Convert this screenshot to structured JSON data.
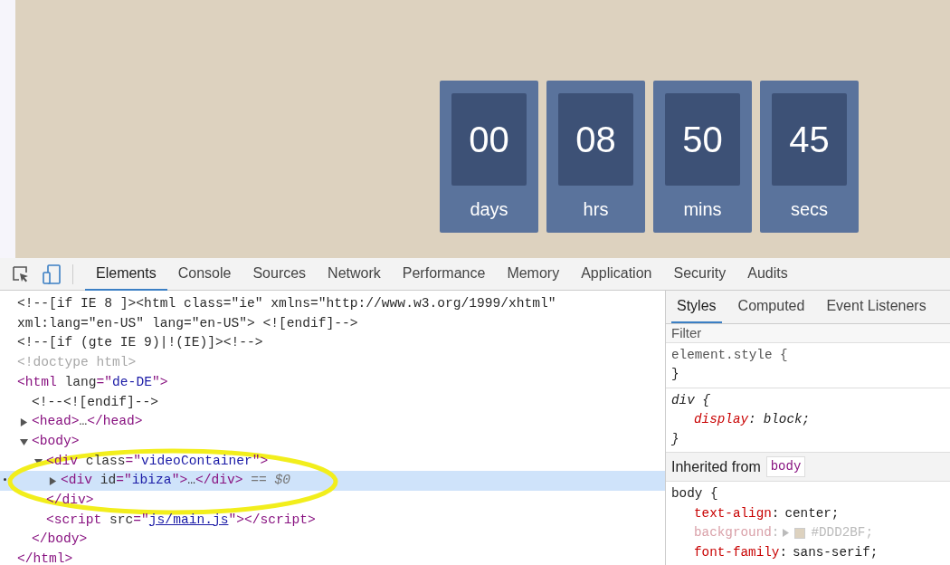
{
  "countdown": [
    {
      "value": "00",
      "label": "days"
    },
    {
      "value": "08",
      "label": "hrs"
    },
    {
      "value": "50",
      "label": "mins"
    },
    {
      "value": "45",
      "label": "secs"
    }
  ],
  "devtools": {
    "tabs": [
      {
        "label": "Elements",
        "selected": true
      },
      {
        "label": "Console",
        "selected": false
      },
      {
        "label": "Sources",
        "selected": false
      },
      {
        "label": "Network",
        "selected": false
      },
      {
        "label": "Performance",
        "selected": false
      },
      {
        "label": "Memory",
        "selected": false
      },
      {
        "label": "Application",
        "selected": false
      },
      {
        "label": "Security",
        "selected": false
      },
      {
        "label": "Audits",
        "selected": false
      }
    ],
    "dom_tree": [
      {
        "tokens": [
          {
            "kind": "comment",
            "text": "<!--[if IE 8 ]><html class=\"ie\" xmlns=\"http://www.w3.org/1999/xhtml\" xml:lang=\"en-US\" lang=\"en-US\"> <![endif]-->"
          }
        ],
        "selected": false
      },
      {
        "tokens": [
          {
            "kind": "comment",
            "text": "<!--[if (gte IE 9)|!(IE)]><!-->"
          }
        ],
        "selected": false
      },
      {
        "tokens": [
          {
            "kind": "doctype",
            "text": "<!doctype html>"
          }
        ],
        "selected": false
      },
      {
        "tokens": [
          {
            "kind": "tag",
            "text": "<html"
          },
          {
            "kind": "attr",
            "text": " lang"
          },
          {
            "kind": "tag",
            "text": "=\""
          },
          {
            "kind": "value",
            "text": "de-DE"
          },
          {
            "kind": "tag",
            "text": "\">"
          }
        ],
        "selected": false,
        "children": [
          {
            "tokens": [
              {
                "kind": "comment",
                "text": "<!--<![endif]-->"
              }
            ],
            "selected": false
          },
          {
            "tokens": [
              {
                "kind": "tag",
                "text": "<head>"
              },
              {
                "kind": "plain",
                "text": "…"
              },
              {
                "kind": "tag",
                "text": "</head>"
              }
            ],
            "expanded": false,
            "selected": false
          },
          {
            "tokens": [
              {
                "kind": "tag",
                "text": "<body>"
              }
            ],
            "expanded": true,
            "selected": false,
            "children": [
              {
                "tokens": [
                  {
                    "kind": "tag",
                    "text": "<div"
                  },
                  {
                    "kind": "attr",
                    "text": " class"
                  },
                  {
                    "kind": "tag",
                    "text": "=\""
                  },
                  {
                    "kind": "value",
                    "text": "videoContainer"
                  },
                  {
                    "kind": "tag",
                    "text": "\">"
                  }
                ],
                "expanded": true,
                "selected": false,
                "children": [
                  {
                    "tokens": [
                      {
                        "kind": "tag",
                        "text": "<div"
                      },
                      {
                        "kind": "attr",
                        "text": " id"
                      },
                      {
                        "kind": "tag",
                        "text": "=\""
                      },
                      {
                        "kind": "value",
                        "text": "ibiza"
                      },
                      {
                        "kind": "tag",
                        "text": "\">"
                      },
                      {
                        "kind": "plain",
                        "text": "…"
                      },
                      {
                        "kind": "tag",
                        "text": "</div>"
                      },
                      {
                        "kind": "marker",
                        "text": " == $0"
                      }
                    ],
                    "expanded": false,
                    "selected": true
                  }
                ],
                "close": [
                  {
                    "kind": "tag",
                    "text": "</div>"
                  }
                ]
              },
              {
                "tokens": [
                  {
                    "kind": "tag",
                    "text": "<script"
                  },
                  {
                    "kind": "attr",
                    "text": " src"
                  },
                  {
                    "kind": "tag",
                    "text": "=\""
                  },
                  {
                    "kind": "link",
                    "text": "js/main.js"
                  },
                  {
                    "kind": "tag",
                    "text": "\"></script>"
                  }
                ],
                "selected": false
              }
            ],
            "close": [
              {
                "kind": "tag",
                "text": "</body>"
              }
            ]
          }
        ],
        "close": [
          {
            "kind": "tag",
            "text": "</html>"
          }
        ]
      }
    ],
    "side_tabs": [
      {
        "label": "Styles",
        "selected": true
      },
      {
        "label": "Computed",
        "selected": false
      },
      {
        "label": "Event Listeners",
        "selected": false
      }
    ],
    "filter": {
      "placeholder": "Filter"
    },
    "rules": [
      {
        "selector": "element.style {",
        "user_agent": false,
        "close": "}"
      },
      {
        "selector": "div {",
        "user_agent": true,
        "properties": [
          {
            "name": "display",
            "separator": ":",
            "value": "block;",
            "inactive": false
          }
        ],
        "close": "}"
      }
    ],
    "inherited": {
      "label": "Inherited from",
      "element": "body"
    },
    "inherited_rule": {
      "selector": "body {",
      "properties": [
        {
          "name": "text-align",
          "separator": ":",
          "value": "center;",
          "inactive": false,
          "kind": "plain"
        },
        {
          "name": "background",
          "separator": ":",
          "value": "#DDD2BF;",
          "inactive": true,
          "kind": "color"
        },
        {
          "name": "font-family",
          "separator": ":",
          "value": "sans-serif;",
          "inactive": false,
          "kind": "plain"
        }
      ]
    }
  }
}
